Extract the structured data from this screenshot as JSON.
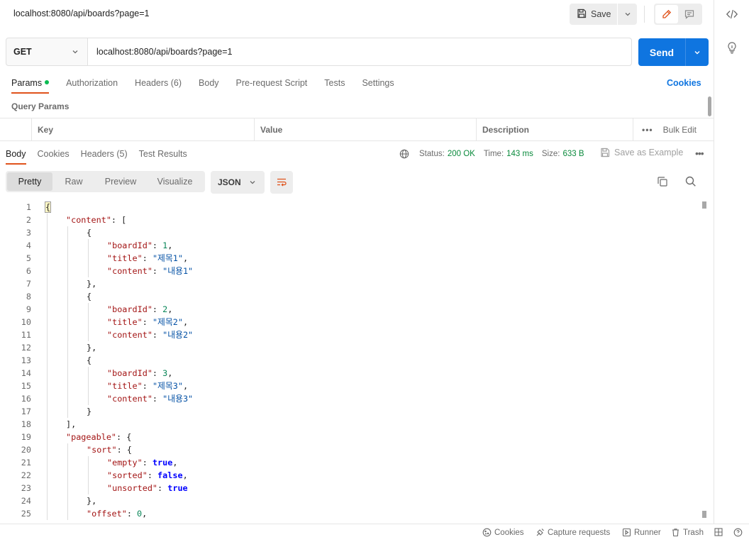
{
  "request": {
    "title": "localhost:8080/api/boards?page=1",
    "method": "GET",
    "url": "localhost:8080/api/boards?page=1",
    "save_label": "Save",
    "send_label": "Send"
  },
  "request_tabs": [
    {
      "label": "Params",
      "active": true,
      "dot": true
    },
    {
      "label": "Authorization"
    },
    {
      "label": "Headers (6)"
    },
    {
      "label": "Body"
    },
    {
      "label": "Pre-request Script"
    },
    {
      "label": "Tests"
    },
    {
      "label": "Settings"
    }
  ],
  "cookies_link": "Cookies",
  "query_params": {
    "title": "Query Params",
    "columns": [
      "Key",
      "Value",
      "Description"
    ],
    "bulk_edit": "Bulk Edit"
  },
  "response_tabs": [
    {
      "label": "Body",
      "active": true
    },
    {
      "label": "Cookies"
    },
    {
      "label": "Headers (5)"
    },
    {
      "label": "Test Results"
    }
  ],
  "response_meta": {
    "status_label": "Status:",
    "status_value": "200 OK",
    "time_label": "Time:",
    "time_value": "143 ms",
    "size_label": "Size:",
    "size_value": "633 B",
    "save_example": "Save as Example"
  },
  "view_modes": [
    "Pretty",
    "Raw",
    "Preview",
    "Visualize"
  ],
  "active_view": "Pretty",
  "format": "JSON",
  "colors": {
    "accent": "#e0531c",
    "send": "#0f75e0",
    "status_ok": "#0a8a3c"
  },
  "code_lines": [
    {
      "n": 1,
      "indent": 0,
      "tokens": [
        [
          "p",
          "{"
        ]
      ]
    },
    {
      "n": 2,
      "indent": 1,
      "tokens": [
        [
          "k",
          "\"content\""
        ],
        [
          "p",
          ": ["
        ]
      ]
    },
    {
      "n": 3,
      "indent": 2,
      "tokens": [
        [
          "p",
          "{"
        ]
      ]
    },
    {
      "n": 4,
      "indent": 3,
      "tokens": [
        [
          "k",
          "\"boardId\""
        ],
        [
          "p",
          ": "
        ],
        [
          "n",
          "1"
        ],
        [
          "p",
          ","
        ]
      ]
    },
    {
      "n": 5,
      "indent": 3,
      "tokens": [
        [
          "k",
          "\"title\""
        ],
        [
          "p",
          ": "
        ],
        [
          "s",
          "\"제목1\""
        ],
        [
          "p",
          ","
        ]
      ]
    },
    {
      "n": 6,
      "indent": 3,
      "tokens": [
        [
          "k",
          "\"content\""
        ],
        [
          "p",
          ": "
        ],
        [
          "s",
          "\"내용1\""
        ]
      ]
    },
    {
      "n": 7,
      "indent": 2,
      "tokens": [
        [
          "p",
          "},"
        ]
      ]
    },
    {
      "n": 8,
      "indent": 2,
      "tokens": [
        [
          "p",
          "{"
        ]
      ]
    },
    {
      "n": 9,
      "indent": 3,
      "tokens": [
        [
          "k",
          "\"boardId\""
        ],
        [
          "p",
          ": "
        ],
        [
          "n",
          "2"
        ],
        [
          "p",
          ","
        ]
      ]
    },
    {
      "n": 10,
      "indent": 3,
      "tokens": [
        [
          "k",
          "\"title\""
        ],
        [
          "p",
          ": "
        ],
        [
          "s",
          "\"제목2\""
        ],
        [
          "p",
          ","
        ]
      ]
    },
    {
      "n": 11,
      "indent": 3,
      "tokens": [
        [
          "k",
          "\"content\""
        ],
        [
          "p",
          ": "
        ],
        [
          "s",
          "\"내용2\""
        ]
      ]
    },
    {
      "n": 12,
      "indent": 2,
      "tokens": [
        [
          "p",
          "},"
        ]
      ]
    },
    {
      "n": 13,
      "indent": 2,
      "tokens": [
        [
          "p",
          "{"
        ]
      ]
    },
    {
      "n": 14,
      "indent": 3,
      "tokens": [
        [
          "k",
          "\"boardId\""
        ],
        [
          "p",
          ": "
        ],
        [
          "n",
          "3"
        ],
        [
          "p",
          ","
        ]
      ]
    },
    {
      "n": 15,
      "indent": 3,
      "tokens": [
        [
          "k",
          "\"title\""
        ],
        [
          "p",
          ": "
        ],
        [
          "s",
          "\"제목3\""
        ],
        [
          "p",
          ","
        ]
      ]
    },
    {
      "n": 16,
      "indent": 3,
      "tokens": [
        [
          "k",
          "\"content\""
        ],
        [
          "p",
          ": "
        ],
        [
          "s",
          "\"내용3\""
        ]
      ]
    },
    {
      "n": 17,
      "indent": 2,
      "tokens": [
        [
          "p",
          "}"
        ]
      ]
    },
    {
      "n": 18,
      "indent": 1,
      "tokens": [
        [
          "p",
          "],"
        ]
      ]
    },
    {
      "n": 19,
      "indent": 1,
      "tokens": [
        [
          "k",
          "\"pageable\""
        ],
        [
          "p",
          ": {"
        ]
      ]
    },
    {
      "n": 20,
      "indent": 2,
      "tokens": [
        [
          "k",
          "\"sort\""
        ],
        [
          "p",
          ": {"
        ]
      ]
    },
    {
      "n": 21,
      "indent": 3,
      "tokens": [
        [
          "k",
          "\"empty\""
        ],
        [
          "p",
          ": "
        ],
        [
          "b",
          "true"
        ],
        [
          "p",
          ","
        ]
      ]
    },
    {
      "n": 22,
      "indent": 3,
      "tokens": [
        [
          "k",
          "\"sorted\""
        ],
        [
          "p",
          ": "
        ],
        [
          "b",
          "false"
        ],
        [
          "p",
          ","
        ]
      ]
    },
    {
      "n": 23,
      "indent": 3,
      "tokens": [
        [
          "k",
          "\"unsorted\""
        ],
        [
          "p",
          ": "
        ],
        [
          "b",
          "true"
        ]
      ]
    },
    {
      "n": 24,
      "indent": 2,
      "tokens": [
        [
          "p",
          "},"
        ]
      ]
    },
    {
      "n": 25,
      "indent": 2,
      "tokens": [
        [
          "k",
          "\"offset\""
        ],
        [
          "p",
          ": "
        ],
        [
          "n",
          "0"
        ],
        [
          "p",
          ","
        ]
      ]
    }
  ],
  "status_bar": [
    {
      "label": "Cookies",
      "icon": "cookie-icon"
    },
    {
      "label": "Capture requests",
      "icon": "capture-icon"
    },
    {
      "label": "Runner",
      "icon": "runner-icon"
    },
    {
      "label": "Trash",
      "icon": "trash-icon"
    }
  ]
}
